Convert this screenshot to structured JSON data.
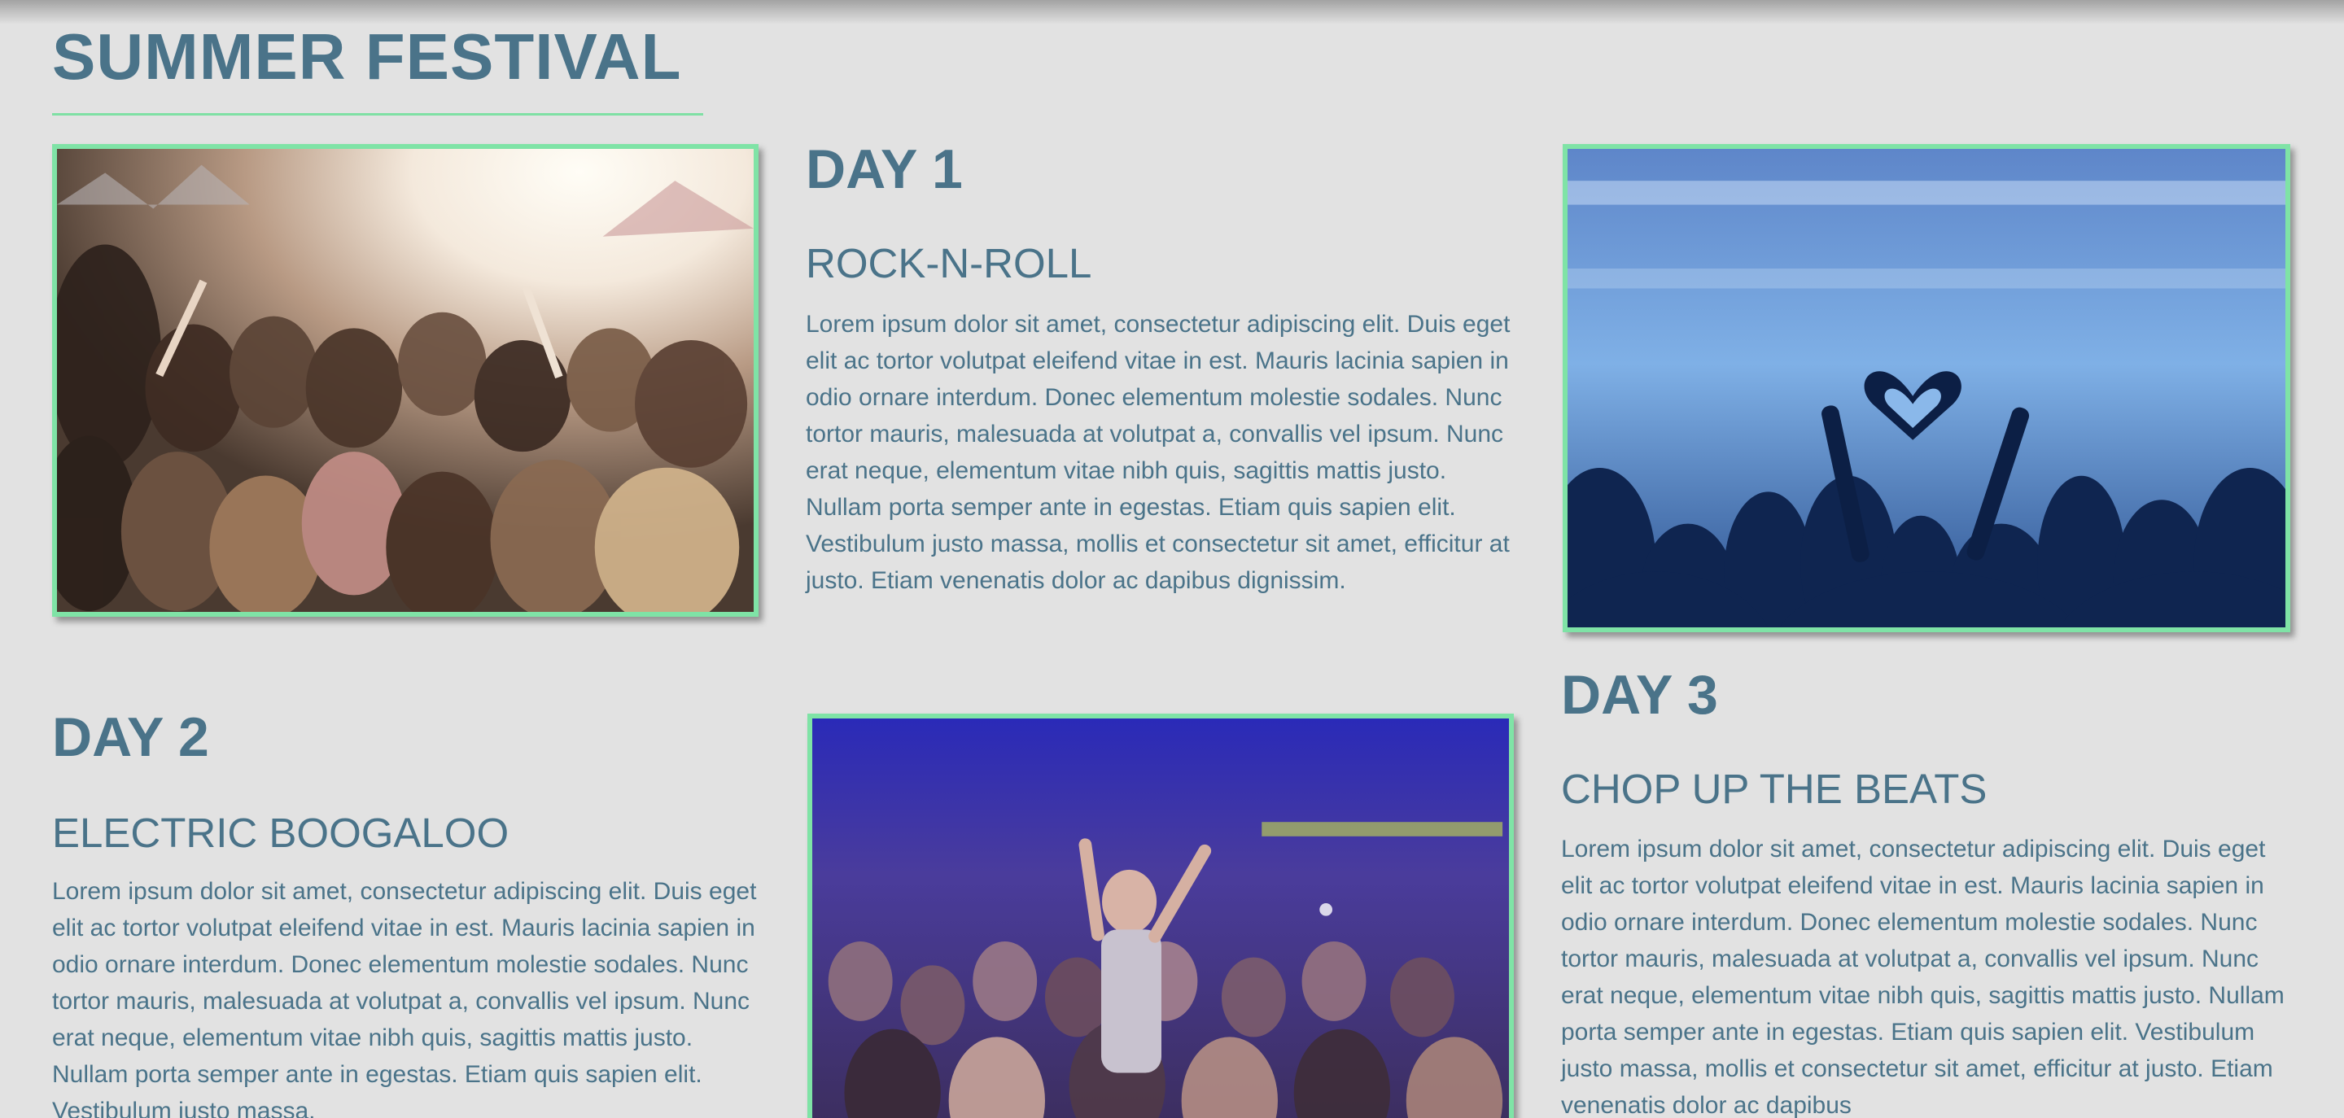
{
  "site": {
    "title": "SUMMER FESTIVAL"
  },
  "days": [
    {
      "heading": "DAY 1",
      "subtitle": "ROCK-N-ROLL",
      "text": "Lorem ipsum dolor sit amet, consectetur adipiscing elit. Duis eget elit ac tortor volutpat eleifend vitae in est. Mauris lacinia sapien in odio ornare interdum. Donec elementum molestie sodales. Nunc tortor mauris, malesuada at volutpat a, convallis vel ipsum. Nunc erat neque, elementum vitae nibh quis, sagittis mattis justo. Nullam porta semper ante in egestas. Etiam quis sapien elit. Vestibulum justo massa, mollis et consectetur sit amet, efficitur at justo. Etiam venenatis dolor ac dapibus dignissim."
    },
    {
      "heading": "DAY 2",
      "subtitle": "ELECTRIC BOOGALOO",
      "text": "Lorem ipsum dolor sit amet, consectetur adipiscing elit. Duis eget elit ac tortor volutpat eleifend vitae in est. Mauris lacinia sapien in odio ornare interdum. Donec elementum molestie sodales. Nunc tortor mauris, malesuada at volutpat a, convallis vel ipsum. Nunc erat neque, elementum vitae nibh quis, sagittis mattis justo. Nullam porta semper ante in egestas. Etiam quis sapien elit. Vestibulum justo massa,"
    },
    {
      "heading": "DAY 3",
      "subtitle": "CHOP UP THE BEATS",
      "text": "Lorem ipsum dolor sit amet, consectetur adipiscing elit. Duis eget elit ac tortor volutpat eleifend vitae in est. Mauris lacinia sapien in odio ornare interdum. Donec elementum molestie sodales. Nunc tortor mauris, malesuada at volutpat a, convallis vel ipsum. Nunc erat neque, elementum vitae nibh quis, sagittis mattis justo. Nullam porta semper ante in egestas. Etiam quis sapien elit. Vestibulum justo massa, mollis et consectetur sit amet, efficitur at justo. Etiam venenatis dolor ac dapibus"
    }
  ],
  "colors": {
    "background": "#e2e2e2",
    "text": "#4a7389",
    "accent": "#7fe3a6"
  },
  "icons": {
    "photo_1": "festival-crowd-sunlight-photo",
    "photo_2": "concert-heart-hands-photo",
    "photo_3": "night-concert-crowd-photo"
  }
}
